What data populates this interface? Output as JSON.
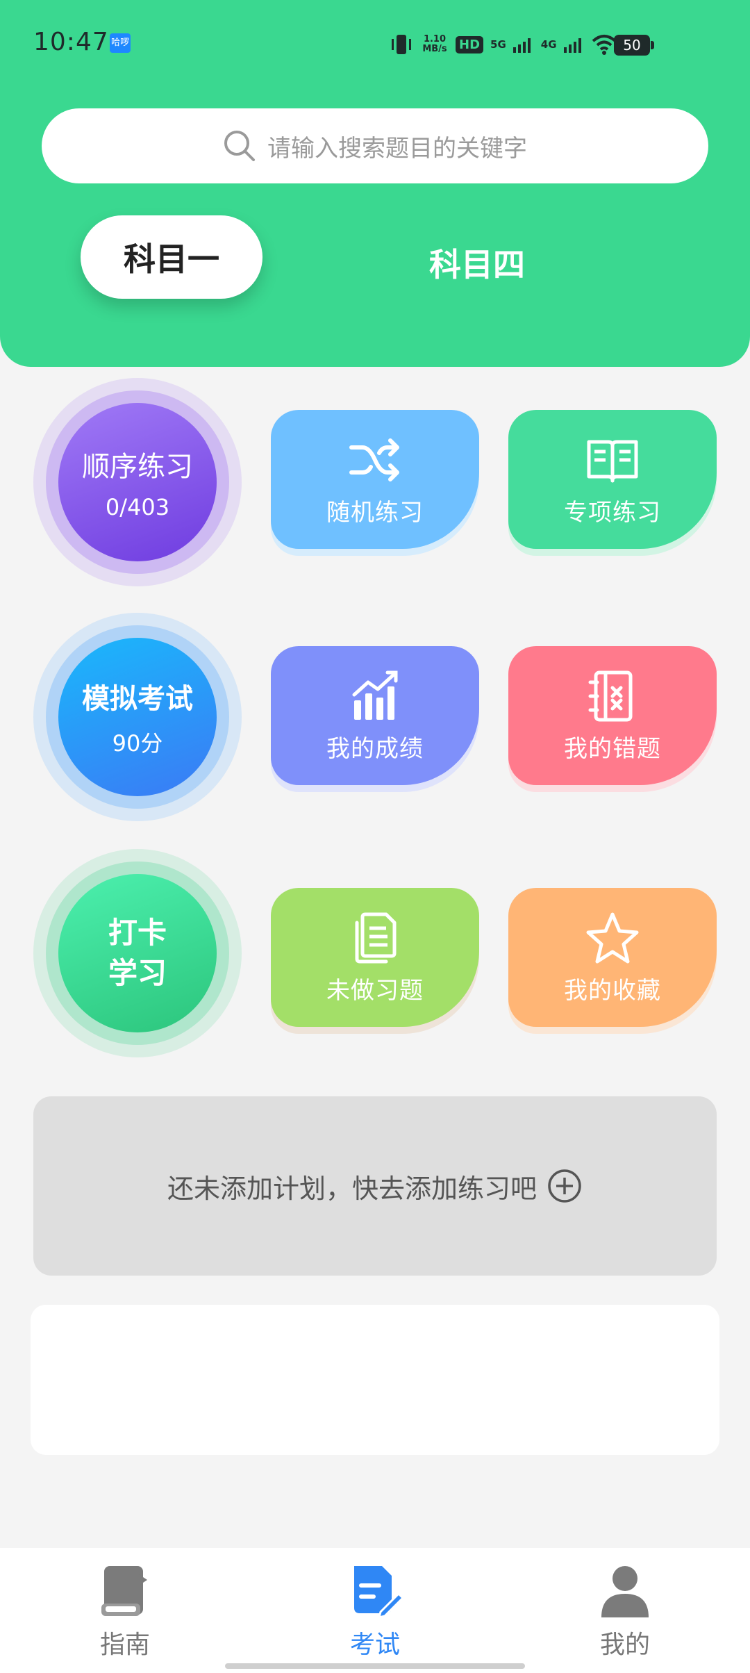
{
  "status_bar": {
    "time": "10:47",
    "app_icon_text": "哈啰",
    "net_speed": "1.10 MB/s",
    "hd_label": "HD",
    "sim1": "5G",
    "sim2": "4G",
    "battery": "50"
  },
  "search": {
    "placeholder": "请输入搜索题目的关键字",
    "icon": "search-icon"
  },
  "tabs": [
    {
      "label": "科目一",
      "active": true
    },
    {
      "label": "科目四",
      "active": false
    }
  ],
  "circles": [
    {
      "title": "顺序练习",
      "subtitle": "0/403",
      "color": "#8a4ff0"
    },
    {
      "title": "模拟考试",
      "subtitle": "90分",
      "color": "#2f8cfb"
    },
    {
      "title": "打卡\n学习",
      "subtitle": "",
      "color": "#36d08a"
    }
  ],
  "tiles": [
    {
      "label": "随机练习",
      "icon": "shuffle-icon",
      "color": "#6fc0ff"
    },
    {
      "label": "专项练习",
      "icon": "open-book-icon",
      "color": "#45dc9c"
    },
    {
      "label": "我的成绩",
      "icon": "bar-chart-icon",
      "color": "#7f90fa"
    },
    {
      "label": "我的错题",
      "icon": "error-notebook-icon",
      "color": "#ff7a8c"
    },
    {
      "label": "未做习题",
      "icon": "documents-icon",
      "color": "#a3df68"
    },
    {
      "label": "我的收藏",
      "icon": "star-icon",
      "color": "#ffb575"
    }
  ],
  "plan": {
    "text": "还未添加计划，快去添加练习吧",
    "icon": "add-circle-icon"
  },
  "nav": [
    {
      "label": "指南",
      "icon": "guide-book-icon",
      "active": false
    },
    {
      "label": "考试",
      "icon": "exam-edit-icon",
      "active": true
    },
    {
      "label": "我的",
      "icon": "user-icon",
      "active": false
    }
  ],
  "colors": {
    "brand_green": "#3ad890",
    "active_blue": "#2f87f5"
  }
}
